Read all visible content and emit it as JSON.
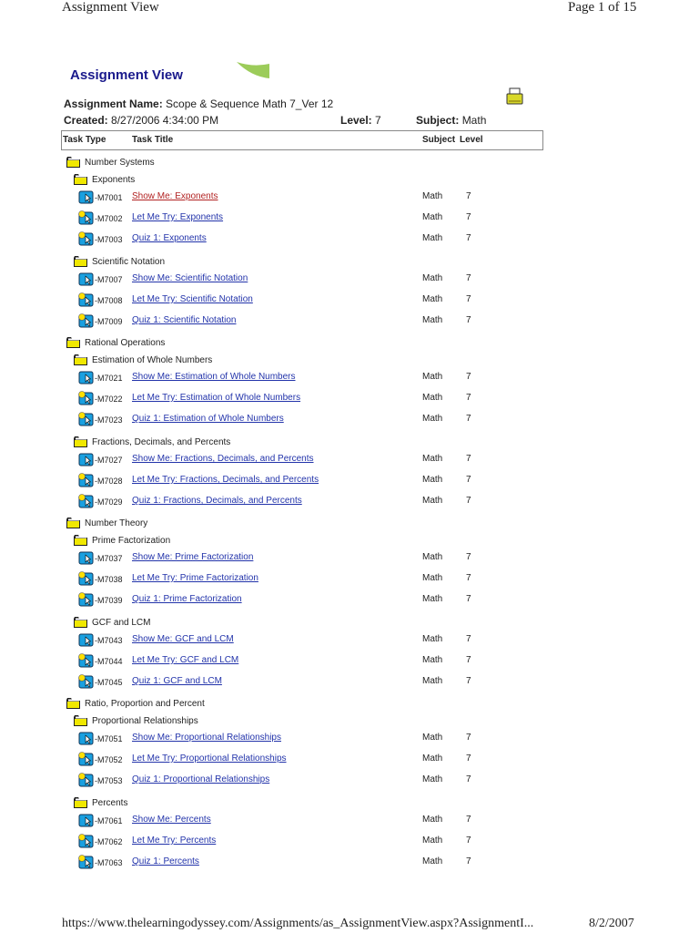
{
  "browser_header": {
    "title": "Assignment View",
    "page": "Page 1 of 15"
  },
  "browser_footer": {
    "url": "https://www.thelearningodyssey.com/Assignments/as_AssignmentView.aspx?AssignmentI...",
    "date": "8/2/2007"
  },
  "page_title": "Assignment View",
  "assignment": {
    "name_label": "Assignment Name:",
    "name": "Scope & Sequence Math 7_Ver 12",
    "created_label": "Created:",
    "created": "8/27/2006 4:34:00 PM",
    "level_label": "Level:",
    "level": "7",
    "subject_label": "Subject:",
    "subject": "Math"
  },
  "table_headers": {
    "task_type": "Task Type",
    "task_title": "Task Title",
    "subject": "Subject",
    "level": "Level"
  },
  "rows": [
    {
      "type": "cat",
      "label": "Number Systems"
    },
    {
      "type": "sub",
      "label": "Exponents"
    },
    {
      "type": "task",
      "kind": "show",
      "code": "-M7001",
      "title": "Show Me: Exponents",
      "subject": "Math",
      "level": "7",
      "visited": true
    },
    {
      "type": "task",
      "kind": "try",
      "code": "-M7002",
      "title": "Let Me Try: Exponents",
      "subject": "Math",
      "level": "7"
    },
    {
      "type": "task",
      "kind": "try",
      "code": "-M7003",
      "title": "Quiz 1: Exponents",
      "subject": "Math",
      "level": "7"
    },
    {
      "type": "sub",
      "label": "Scientific Notation"
    },
    {
      "type": "task",
      "kind": "show",
      "code": "-M7007",
      "title": "Show Me: Scientific Notation",
      "subject": "Math",
      "level": "7"
    },
    {
      "type": "task",
      "kind": "try",
      "code": "-M7008",
      "title": "Let Me Try: Scientific Notation",
      "subject": "Math",
      "level": "7"
    },
    {
      "type": "task",
      "kind": "try",
      "code": "-M7009",
      "title": "Quiz 1: Scientific Notation",
      "subject": "Math",
      "level": "7"
    },
    {
      "type": "cat",
      "label": "Rational Operations"
    },
    {
      "type": "sub",
      "label": "Estimation of Whole Numbers"
    },
    {
      "type": "task",
      "kind": "show",
      "code": "-M7021",
      "title": "Show Me: Estimation of Whole Numbers",
      "subject": "Math",
      "level": "7"
    },
    {
      "type": "task",
      "kind": "try",
      "code": "-M7022",
      "title": "Let Me Try: Estimation of Whole Numbers",
      "subject": "Math",
      "level": "7"
    },
    {
      "type": "task",
      "kind": "try",
      "code": "-M7023",
      "title": "Quiz 1: Estimation of Whole Numbers",
      "subject": "Math",
      "level": "7"
    },
    {
      "type": "sub",
      "label": "Fractions, Decimals, and Percents"
    },
    {
      "type": "task",
      "kind": "show",
      "code": "-M7027",
      "title": "Show Me: Fractions, Decimals, and Percents",
      "subject": "Math",
      "level": "7"
    },
    {
      "type": "task",
      "kind": "try",
      "code": "-M7028",
      "title": "Let Me Try: Fractions, Decimals, and Percents",
      "subject": "Math",
      "level": "7"
    },
    {
      "type": "task",
      "kind": "try",
      "code": "-M7029",
      "title": "Quiz 1: Fractions, Decimals, and Percents",
      "subject": "Math",
      "level": "7"
    },
    {
      "type": "cat",
      "label": "Number Theory"
    },
    {
      "type": "sub",
      "label": "Prime Factorization"
    },
    {
      "type": "task",
      "kind": "show",
      "code": "-M7037",
      "title": "Show Me: Prime Factorization",
      "subject": "Math",
      "level": "7"
    },
    {
      "type": "task",
      "kind": "try",
      "code": "-M7038",
      "title": "Let Me Try: Prime Factorization",
      "subject": "Math",
      "level": "7"
    },
    {
      "type": "task",
      "kind": "try",
      "code": "-M7039",
      "title": "Quiz 1: Prime Factorization",
      "subject": "Math",
      "level": "7"
    },
    {
      "type": "sub",
      "label": "GCF and LCM"
    },
    {
      "type": "task",
      "kind": "show",
      "code": "-M7043",
      "title": "Show Me: GCF and LCM",
      "subject": "Math",
      "level": "7"
    },
    {
      "type": "task",
      "kind": "try",
      "code": "-M7044",
      "title": "Let Me Try: GCF and LCM",
      "subject": "Math",
      "level": "7"
    },
    {
      "type": "task",
      "kind": "try",
      "code": "-M7045",
      "title": "Quiz 1: GCF and LCM",
      "subject": "Math",
      "level": "7"
    },
    {
      "type": "cat",
      "label": "Ratio, Proportion and Percent"
    },
    {
      "type": "sub",
      "label": "Proportional Relationships"
    },
    {
      "type": "task",
      "kind": "show",
      "code": "-M7051",
      "title": "Show Me: Proportional Relationships",
      "subject": "Math",
      "level": "7"
    },
    {
      "type": "task",
      "kind": "try",
      "code": "-M7052",
      "title": "Let Me Try: Proportional Relationships",
      "subject": "Math",
      "level": "7"
    },
    {
      "type": "task",
      "kind": "try",
      "code": "-M7053",
      "title": "Quiz 1: Proportional Relationships",
      "subject": "Math",
      "level": "7"
    },
    {
      "type": "sub",
      "label": "Percents"
    },
    {
      "type": "task",
      "kind": "show",
      "code": "-M7061",
      "title": "Show Me: Percents",
      "subject": "Math",
      "level": "7"
    },
    {
      "type": "task",
      "kind": "try",
      "code": "-M7062",
      "title": "Let Me Try: Percents",
      "subject": "Math",
      "level": "7"
    },
    {
      "type": "task",
      "kind": "try",
      "code": "-M7063",
      "title": "Quiz 1: Percents",
      "subject": "Math",
      "level": "7"
    }
  ]
}
